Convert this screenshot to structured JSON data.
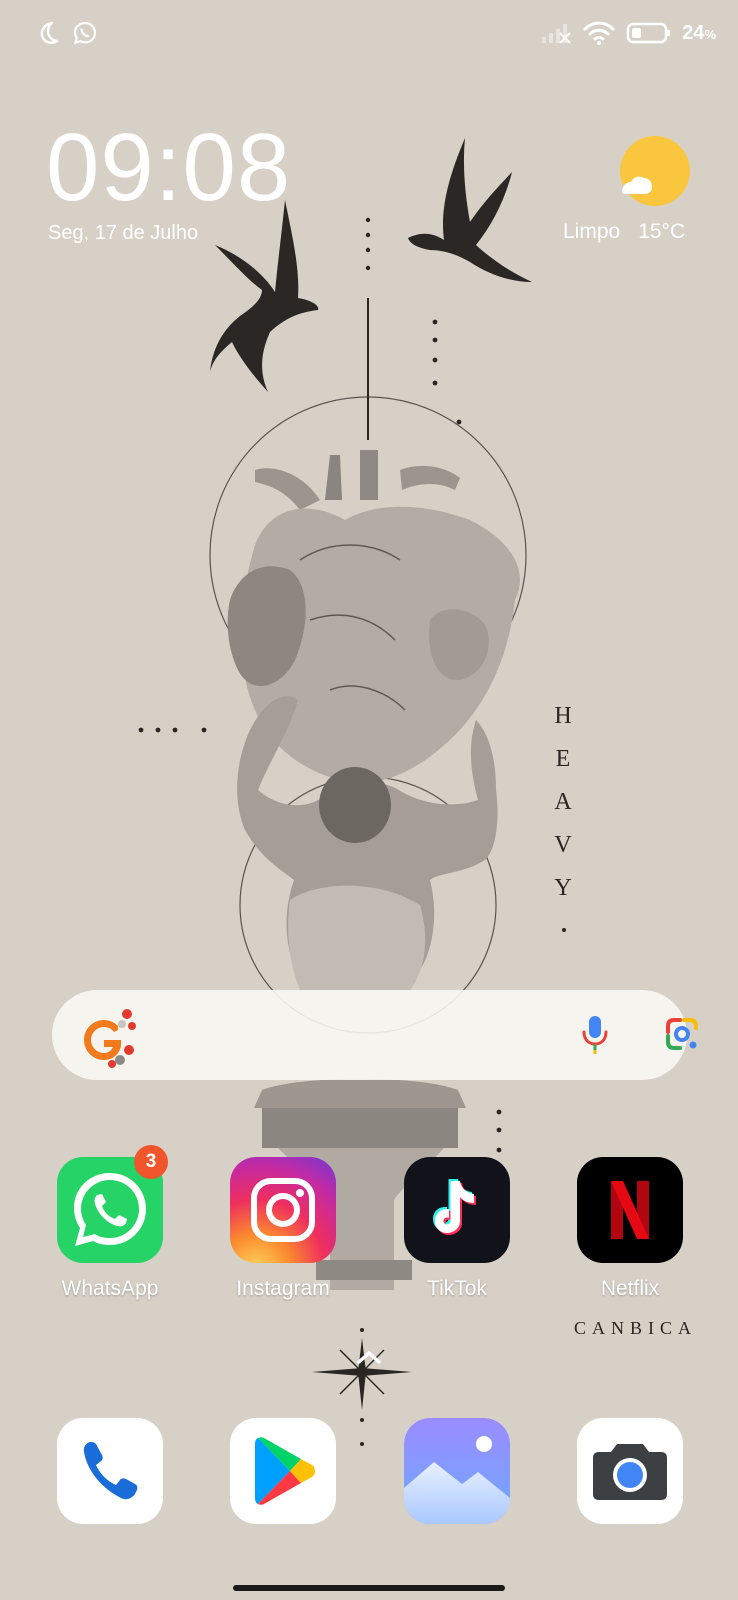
{
  "status_bar": {
    "left_icons": [
      "moon-icon",
      "whatsapp-notification-icon"
    ],
    "right_icons": [
      "no-signal-icon",
      "wifi-icon",
      "battery-icon"
    ],
    "battery_percent": "24",
    "battery_unit": "%"
  },
  "clock": {
    "time": "09:08",
    "date": "Seg, 17 de Julho"
  },
  "weather": {
    "condition": "Limpo",
    "temperature": "15°C",
    "icon": "sun-cloud-icon"
  },
  "wallpaper": {
    "vertical_text": [
      "H",
      "E",
      "A",
      "V",
      "Y"
    ],
    "brand": "CANBICA"
  },
  "search": {
    "logo_icon": "google-logo-icon",
    "mic_icon": "mic-icon",
    "lens_icon": "google-lens-icon"
  },
  "apps": [
    {
      "label": "WhatsApp",
      "badge": "3",
      "icon": "whatsapp-icon"
    },
    {
      "label": "Instagram",
      "icon": "instagram-icon"
    },
    {
      "label": "TikTok",
      "icon": "tiktok-icon"
    },
    {
      "label": "Netflix",
      "icon": "netflix-icon"
    }
  ],
  "dock": [
    {
      "icon": "phone-icon"
    },
    {
      "icon": "play-store-icon"
    },
    {
      "icon": "gallery-icon"
    },
    {
      "icon": "camera-icon"
    }
  ],
  "colors": {
    "wallpaper": "#d7d0c7",
    "whatsapp": "#25d366",
    "netflix": "#e50914",
    "badge": "#f0552b",
    "sun": "#f9c63d"
  }
}
